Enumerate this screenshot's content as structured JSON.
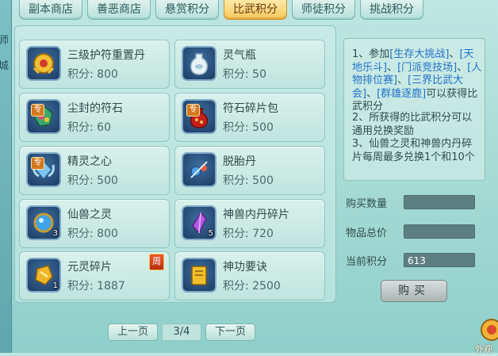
{
  "sidebar": {
    "glyph_1": "师",
    "glyph_2": "城"
  },
  "tabs": [
    {
      "label": "副本商店",
      "active": false
    },
    {
      "label": "善恶商店",
      "active": false
    },
    {
      "label": "悬赏积分",
      "active": false
    },
    {
      "label": "比武积分",
      "active": true
    },
    {
      "label": "师徒积分",
      "active": false
    },
    {
      "label": "挑战积分",
      "active": false
    }
  ],
  "items": [
    {
      "name": "三级护符重置丹",
      "price": "积分: 800",
      "icon": "gold-amulet-icon"
    },
    {
      "name": "灵气瓶",
      "price": "积分: 50",
      "icon": "white-vase-icon"
    },
    {
      "name": "尘封的符石",
      "price": "积分: 60",
      "icon": "colorful-rune-stone-icon",
      "badge": "专"
    },
    {
      "name": "符石碎片包",
      "price": "积分: 500",
      "icon": "red-bag-icon",
      "badge": "专"
    },
    {
      "name": "精灵之心",
      "price": "积分: 500",
      "icon": "blue-spirit-heart-icon",
      "badge": "专"
    },
    {
      "name": "脱胎丹",
      "price": "积分: 500",
      "icon": "blue-pill-icon"
    },
    {
      "name": "仙兽之灵",
      "price": "积分: 800",
      "icon": "blue-orb-icon",
      "qty": "3"
    },
    {
      "name": "神兽内丹碎片",
      "price": "积分: 720",
      "icon": "purple-crystal-icon",
      "qty": "5"
    },
    {
      "name": "元灵碎片",
      "price": "积分: 1887",
      "icon": "gold-fragment-icon",
      "qty": "1",
      "weekly": "周"
    },
    {
      "name": "神功要诀",
      "price": "积分: 2500",
      "icon": "gold-book-icon"
    }
  ],
  "pager": {
    "prev": "上一页",
    "page": "3/4",
    "next": "下一页"
  },
  "rules": {
    "r1a": "1、参加",
    "r1b": "[生存大挑战]",
    "r1c": "、",
    "r1d": "[天地乐斗]",
    "r1e": "、",
    "r1f": "[门派竞技场]",
    "r1g": "、",
    "r1h": "[人物排位赛]",
    "r1i": "、",
    "r1j": "[三界比武大会]",
    "r1k": "、",
    "r1l": "[群雄逐鹿]",
    "r1m": "可以获得比武积分",
    "r2": "2、所获得的比武积分可以通用兑换奖励",
    "r3": "3、仙兽之灵和神兽内丹碎片每周最多兑换1个和10个"
  },
  "fields": {
    "qty_label": "购买数量",
    "qty_value": "",
    "total_label": "物品总价",
    "total_value": "",
    "points_label": "当前积分",
    "points_value": "613"
  },
  "buy_label": "购买",
  "corner": {
    "text": "外观"
  },
  "colors": {
    "accent": "#f3c85c",
    "link": "#2273c9",
    "panel": "#bfe4de"
  }
}
